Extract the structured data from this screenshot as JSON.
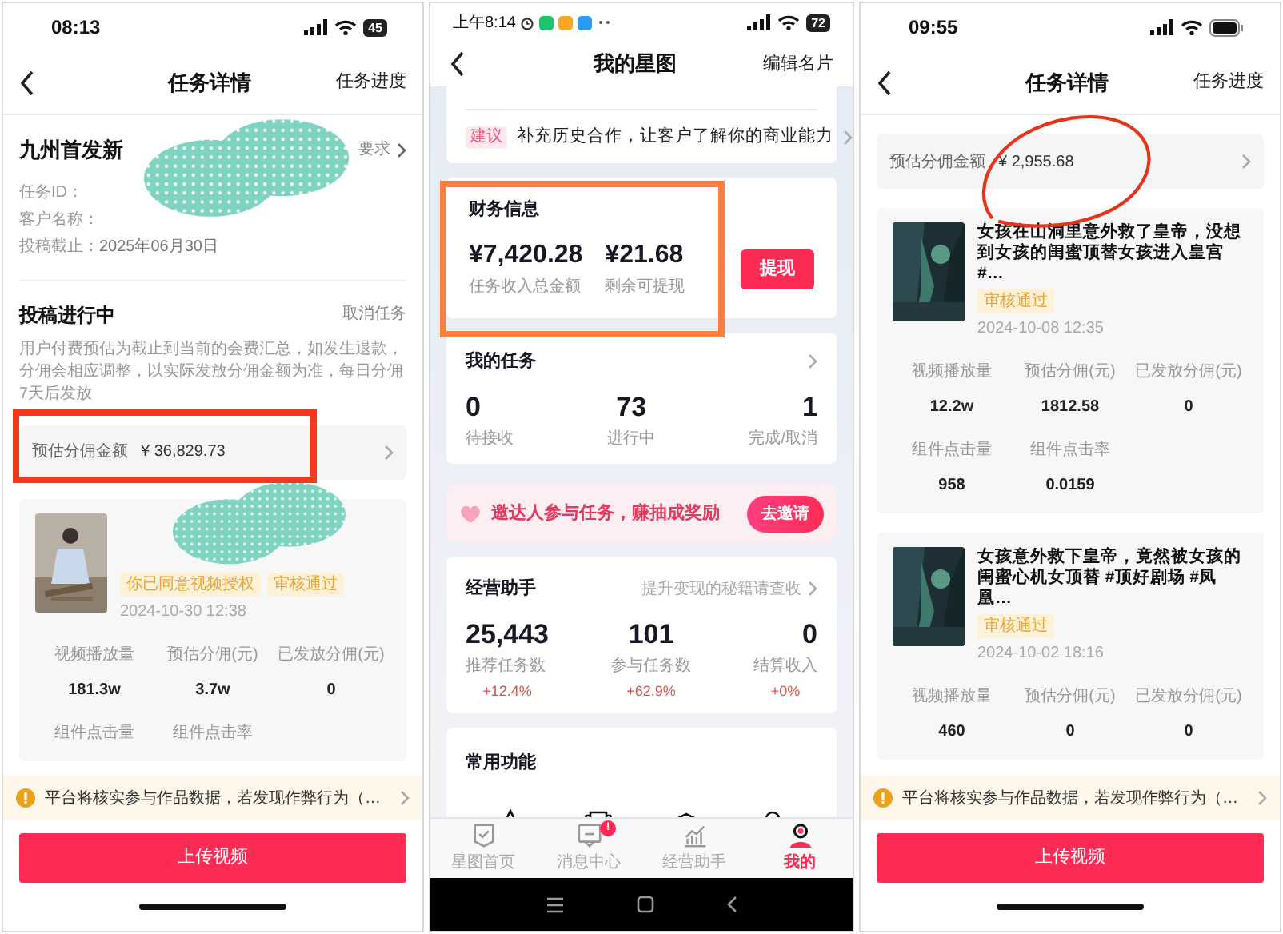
{
  "phones": [
    {
      "kind": "task_detail",
      "status_bar": {
        "time": "08:13",
        "battery": "45"
      },
      "header": {
        "title": "任务详情",
        "action": "任务进度"
      },
      "task_info": {
        "title": "九州首发新",
        "link": "要求",
        "fields": [
          {
            "label": "任务ID："
          },
          {
            "label": "客户名称："
          },
          {
            "label": "投稿截止：",
            "value": "2025年06月30日"
          }
        ]
      },
      "progress": {
        "title": "投稿进行中",
        "action": "取消任务",
        "description": "用户付费预估为截止到当前的会费汇总，如发生退款，分佣会相应调整，以实际发放分佣金额为准，每日分佣7天后发放"
      },
      "commission": {
        "label": "预估分佣金额",
        "amount": "¥ 36,829.73"
      },
      "videos": [
        {
          "tags": [
            "你已同意视频授权",
            "审核通过"
          ],
          "date": "2024-10-30 12:38",
          "stats": [
            {
              "label": "视频播放量",
              "value": "181.3w"
            },
            {
              "label": "预估分佣(元)",
              "value": "3.7w"
            },
            {
              "label": "已发放分佣(元)",
              "value": "0"
            },
            {
              "label": "组件点击量"
            },
            {
              "label": "组件点击率"
            }
          ]
        }
      ],
      "notice": "平台将核实参与作品数据，若发现作弊行为（…",
      "upload_button": "上传视频"
    },
    {
      "kind": "star_map",
      "status_bar": {
        "time": "上午8:14",
        "battery": "72"
      },
      "header": {
        "title": "我的星图",
        "action": "编辑名片"
      },
      "suggestion": {
        "tag": "建议",
        "text": "补充历史合作，让客户了解你的商业能力"
      },
      "finance": {
        "title": "财务信息",
        "amounts": [
          {
            "value": "¥7,420.28",
            "label": "任务收入总金额"
          },
          {
            "value": "¥21.68",
            "label": "剩余可提现"
          }
        ],
        "button": "提现"
      },
      "my_tasks": {
        "title": "我的任务",
        "stats": [
          {
            "value": "0",
            "label": "待接收"
          },
          {
            "value": "73",
            "label": "进行中"
          },
          {
            "value": "1",
            "label": "完成/取消"
          }
        ]
      },
      "invite": {
        "text": "邀达人参与任务，赚抽成奖励",
        "button": "去邀请"
      },
      "assistant": {
        "title": "经营助手",
        "link": "提升变现的秘籍请查收",
        "stats": [
          {
            "value": "25,443",
            "label": "推荐任务数",
            "change": "+12.4%"
          },
          {
            "value": "101",
            "label": "参与任务数",
            "change": "+62.9%"
          },
          {
            "value": "0",
            "label": "结算收入",
            "change": "+0%"
          }
        ]
      },
      "common": {
        "title": "常用功能"
      },
      "tab_bar": [
        {
          "label": "星图首页",
          "selected": false
        },
        {
          "label": "消息中心",
          "selected": false,
          "badge": "!"
        },
        {
          "label": "经营助手",
          "selected": false
        },
        {
          "label": "我的",
          "selected": true
        }
      ]
    },
    {
      "kind": "task_detail",
      "status_bar": {
        "time": "09:55"
      },
      "header": {
        "title": "任务详情",
        "action": "任务进度"
      },
      "commission": {
        "label": "预估分佣金额",
        "amount": "¥ 2,955.68"
      },
      "videos": [
        {
          "title": "女孩在山洞里意外救了皇帝，没想到女孩的闺蜜顶替女孩进入皇宫 #…",
          "tags": [
            "审核通过"
          ],
          "date": "2024-10-08 12:35",
          "stats": [
            {
              "label": "视频播放量",
              "value": "12.2w"
            },
            {
              "label": "预估分佣(元)",
              "value": "1812.58"
            },
            {
              "label": "已发放分佣(元)",
              "value": "0"
            },
            {
              "label": "组件点击量",
              "value": "958"
            },
            {
              "label": "组件点击率",
              "value": "0.0159"
            }
          ]
        },
        {
          "title": "女孩意外救下皇帝，竟然被女孩的闺蜜心机女顶替 #顶好剧场 #凤凰…",
          "tags": [
            "审核通过"
          ],
          "date": "2024-10-02 18:16",
          "stats": [
            {
              "label": "视频播放量",
              "value": "460"
            },
            {
              "label": "预估分佣(元)",
              "value": "0"
            },
            {
              "label": "已发放分佣(元)",
              "value": "0"
            }
          ]
        }
      ],
      "notice": "平台将核实参与作品数据，若发现作弊行为（…",
      "upload_button": "上传视频"
    }
  ]
}
